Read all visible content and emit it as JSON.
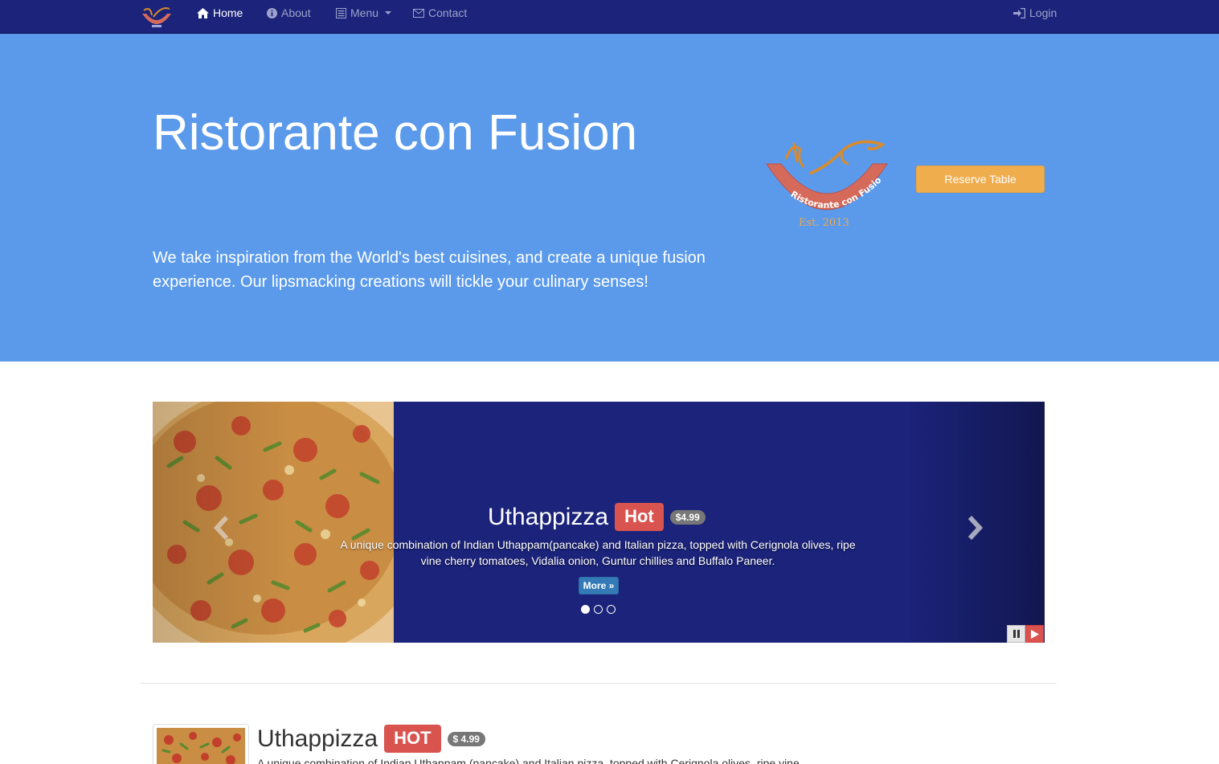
{
  "nav": {
    "home": "Home",
    "about": "About",
    "menu": "Menu",
    "contact": "Contact",
    "login": "Login"
  },
  "hero": {
    "title": "Ristorante con Fusion",
    "description": "We take inspiration from the World's best cuisines, and create a unique fusion experience. Our lipsmacking creations will tickle your culinary senses!",
    "reserve_label": "Reserve Table",
    "logo_text": "Ristorante con Fusion",
    "logo_est": "Est. 2013"
  },
  "carousel": {
    "title": "Uthappizza",
    "badge": "Hot",
    "price": "$4.99",
    "description": "A unique combination of Indian Uthappam(pancake) and Italian pizza, topped with Cerignola olives, ripe vine cherry tomatoes, Vidalia onion, Guntur chillies and Buffalo Paneer.",
    "more_label": "More »",
    "active_slide": 1,
    "slide_count": 3
  },
  "featured": {
    "title": "Uthappizza",
    "badge": "HOT",
    "price": "$ 4.99",
    "description": "A unique combination of Indian Uthappam (pancake) and Italian pizza, topped with Cerignola olives, ripe vine"
  },
  "colors": {
    "navbar": "#1b237a",
    "hero": "#5b9aeb",
    "reserve": "#f0ad4e",
    "hot": "#d9534f",
    "more": "#337ab7"
  },
  "icons": {
    "home": "home-icon",
    "about": "info-sign-icon",
    "menu": "list-alt-icon",
    "contact": "envelope-icon",
    "login": "log-in-icon"
  }
}
